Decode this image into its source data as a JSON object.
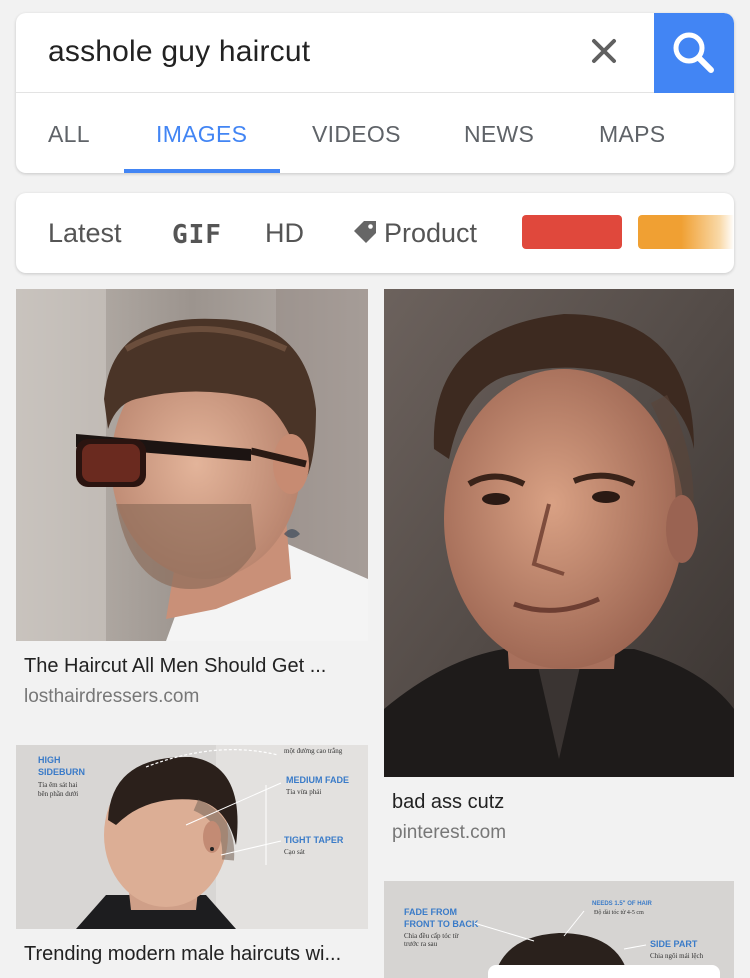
{
  "search": {
    "query": "asshole guy haircut"
  },
  "tabs": [
    {
      "label": "ALL"
    },
    {
      "label": "IMAGES"
    },
    {
      "label": "VIDEOS"
    },
    {
      "label": "NEWS"
    },
    {
      "label": "MAPS"
    }
  ],
  "filters": {
    "latest": "Latest",
    "gif": "GIF",
    "hd": "HD",
    "product": "Product",
    "colors": [
      "#e0483c",
      "#f0a033"
    ]
  },
  "results": [
    {
      "caption": "The Haircut All Men Should Get ...",
      "source": "losthairdressers.com"
    },
    {
      "caption": "bad ass cutz",
      "source": "pinterest.com"
    },
    {
      "caption": "Trending modern male haircuts wi...",
      "source": "",
      "labels": {
        "high_sideburn": "HIGH\nSIDEBURN",
        "medium_fade": "MEDIUM FADE",
        "tight_taper": "TIGHT TAPER",
        "top_note": "một đường cao trắng"
      }
    },
    {
      "caption": "",
      "source": "",
      "labels": {
        "fade": "FADE FROM\nFRONT TO BACK",
        "side_part": "SIDE PART"
      }
    }
  ],
  "colors": {
    "accent": "#4285f4",
    "card": "#ffffff",
    "background": "#f2f2f2"
  }
}
